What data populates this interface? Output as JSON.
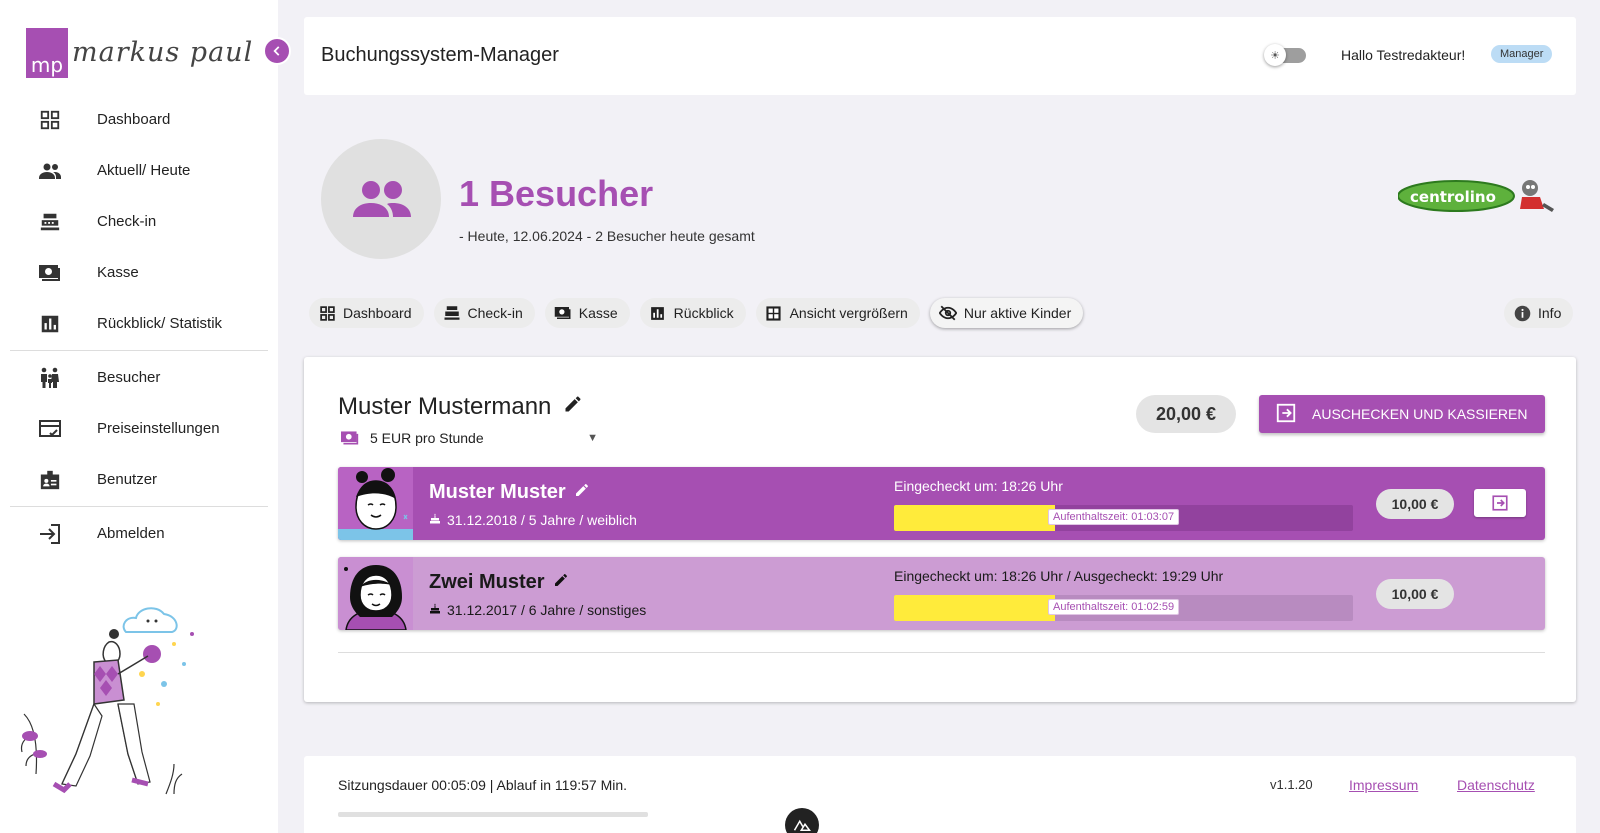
{
  "brand": {
    "logo_mark": "mp",
    "logo_name": "markus paul",
    "partner_logo": "centrolino"
  },
  "colors": {
    "accent": "#a64fb2",
    "accent_light": "#cc9cd3",
    "progress": "#ffeb3b",
    "badge": "#bcdcf5"
  },
  "sidebar": {
    "items": [
      {
        "label": "Dashboard",
        "icon": "dashboard-icon"
      },
      {
        "label": "Aktuell/ Heute",
        "icon": "people-icon"
      },
      {
        "label": "Check-in",
        "icon": "cash-register-icon"
      },
      {
        "label": "Kasse",
        "icon": "money-icon"
      },
      {
        "label": "Rückblick/ Statistik",
        "icon": "bar-chart-icon"
      },
      {
        "label": "Besucher",
        "icon": "family-icon"
      },
      {
        "label": "Preiseinstellungen",
        "icon": "price-card-icon"
      },
      {
        "label": "Benutzer",
        "icon": "badge-icon"
      },
      {
        "label": "Abmelden",
        "icon": "logout-icon"
      }
    ]
  },
  "header": {
    "title": "Buchungssystem-Manager",
    "greeting": "Hallo Testredakteur!",
    "role": "Manager"
  },
  "hero": {
    "title": "1 Besucher",
    "subtitle": "- Heute, 12.06.2024 - 2 Besucher heute gesamt"
  },
  "actions": {
    "items": [
      {
        "label": "Dashboard",
        "icon": "dashboard-icon"
      },
      {
        "label": "Check-in",
        "icon": "cash-register-icon"
      },
      {
        "label": "Kasse",
        "icon": "money-icon"
      },
      {
        "label": "Rückblick",
        "icon": "bar-chart-icon"
      },
      {
        "label": "Ansicht vergrößern",
        "icon": "fullscreen-icon"
      },
      {
        "label": "Nur aktive Kinder",
        "icon": "eye-off-icon"
      }
    ],
    "info": "Info"
  },
  "booking": {
    "guardian": "Muster Mustermann",
    "tariff": "5 EUR pro Stunde",
    "total": "20,00 €",
    "checkout_label": "Auschecken und kassieren",
    "children": [
      {
        "name": "Muster Muster",
        "info": "31.12.2018 / 5 Jahre / weiblich",
        "checkin": "Eingecheckt um: 18:26 Uhr",
        "duration": "Aufenthaltszeit: 01:03:07",
        "progress": 0.35,
        "amount": "10,00 €"
      },
      {
        "name": "Zwei Muster",
        "info": "31.12.2017 / 6 Jahre / sonstiges",
        "checkin": "Eingecheckt um: 18:26 Uhr / Ausgecheckt: 19:29 Uhr",
        "duration": "Aufenthaltszeit: 01:02:59",
        "progress": 0.35,
        "amount": "10,00 €"
      }
    ]
  },
  "footer": {
    "session": "Sitzungsdauer 00:05:09 | Ablauf in 119:57 Min.",
    "version": "v1.1.20",
    "impressum": "Impressum",
    "datenschutz": "Datenschutz"
  }
}
